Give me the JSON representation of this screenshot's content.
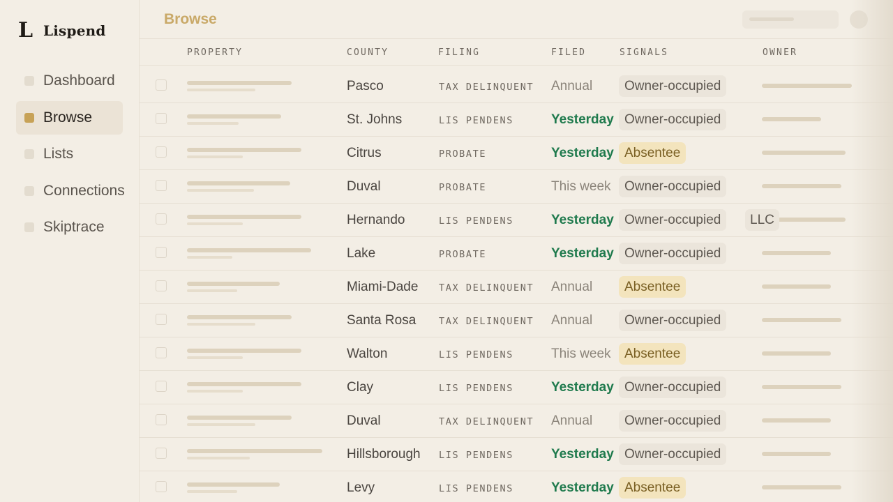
{
  "app": {
    "logo_mark": "L",
    "name": "Lispend"
  },
  "sidebar": {
    "items": [
      {
        "label": "Dashboard",
        "active": false
      },
      {
        "label": "Browse",
        "active": true
      },
      {
        "label": "Lists",
        "active": false
      },
      {
        "label": "Connections",
        "active": false
      },
      {
        "label": "Skiptrace",
        "active": false
      }
    ]
  },
  "header": {
    "title": "Browse"
  },
  "table": {
    "columns": {
      "property": "PROPERTY",
      "county": "COUNTY",
      "filing": "FILING",
      "filed": "FILED",
      "signals": "SIGNALS",
      "owner": "OWNER"
    },
    "rows": [
      {
        "county": "Pasco",
        "filing": "TAX DELINQUENT",
        "filed": "Annual",
        "signal": "Owner-occupied",
        "extra": ""
      },
      {
        "county": "St. Johns",
        "filing": "LIS PENDENS",
        "filed": "Yesterday",
        "signal": "Owner-occupied",
        "extra": ""
      },
      {
        "county": "Citrus",
        "filing": "PROBATE",
        "filed": "Yesterday",
        "signal": "Absentee",
        "extra": ""
      },
      {
        "county": "Duval",
        "filing": "PROBATE",
        "filed": "This week",
        "signal": "Owner-occupied",
        "extra": ""
      },
      {
        "county": "Hernando",
        "filing": "LIS PENDENS",
        "filed": "Yesterday",
        "signal": "Owner-occupied",
        "extra": "LLC"
      },
      {
        "county": "Lake",
        "filing": "PROBATE",
        "filed": "Yesterday",
        "signal": "Owner-occupied",
        "extra": ""
      },
      {
        "county": "Miami-Dade",
        "filing": "TAX DELINQUENT",
        "filed": "Annual",
        "signal": "Absentee",
        "extra": ""
      },
      {
        "county": "Santa Rosa",
        "filing": "TAX DELINQUENT",
        "filed": "Annual",
        "signal": "Owner-occupied",
        "extra": ""
      },
      {
        "county": "Walton",
        "filing": "LIS PENDENS",
        "filed": "This week",
        "signal": "Absentee",
        "extra": ""
      },
      {
        "county": "Clay",
        "filing": "LIS PENDENS",
        "filed": "Yesterday",
        "signal": "Owner-occupied",
        "extra": ""
      },
      {
        "county": "Duval",
        "filing": "TAX DELINQUENT",
        "filed": "Annual",
        "signal": "Owner-occupied",
        "extra": ""
      },
      {
        "county": "Hillsborough",
        "filing": "LIS PENDENS",
        "filed": "Yesterday",
        "signal": "Owner-occupied",
        "extra": ""
      },
      {
        "county": "Levy",
        "filing": "LIS PENDENS",
        "filed": "Yesterday",
        "signal": "Absentee",
        "extra": ""
      }
    ]
  },
  "colors": {
    "accent": "#c7a257",
    "recent": "#1f7a4d",
    "absentee_bg": "#f3e4bd",
    "background": "#f3eee5"
  }
}
